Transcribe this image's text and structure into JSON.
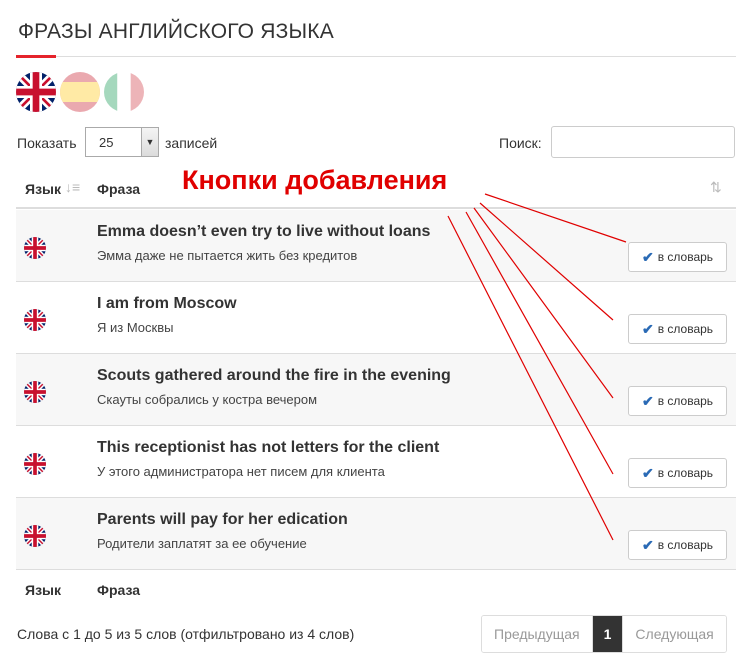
{
  "page": {
    "title": "ФРАЗЫ АНГЛИЙСКОГО ЯЗЫКА",
    "accent_color": "#e5232b"
  },
  "languages": [
    {
      "name": "uk-flag-icon",
      "active": true
    },
    {
      "name": "spain-flag-icon",
      "active": false
    },
    {
      "name": "italy-flag-icon",
      "active": false
    }
  ],
  "controls": {
    "show_label": "Показать",
    "page_size": "25",
    "records_label": "записей",
    "search_label": "Поиск:",
    "search_value": ""
  },
  "table": {
    "col_lang": "Язык",
    "col_phrase": "Фраза",
    "button_label": "в словарь",
    "rows": [
      {
        "phrase": "Emma doesn’t even try to live without loans",
        "translation": "Эмма даже не пытается жить без кредитов"
      },
      {
        "phrase": "I am from Moscow",
        "translation": "Я из Москвы"
      },
      {
        "phrase": "Scouts gathered around the fire in the evening",
        "translation": "Скауты собрались у костра вечером"
      },
      {
        "phrase": "This receptionist has not letters for the client",
        "translation": "У этого администратора нет писем для клиента"
      },
      {
        "phrase": "Parents will pay for her edication",
        "translation": "Родители заплатят за ее обучение"
      }
    ]
  },
  "footer": {
    "info": "Слова с 1 до 5 из 5 слов (отфильтровано из 4 слов)",
    "prev": "Предыдущая",
    "current": "1",
    "next": "Следующая"
  },
  "annotation": {
    "text": "Кнопки добавления",
    "color": "#e00000"
  }
}
